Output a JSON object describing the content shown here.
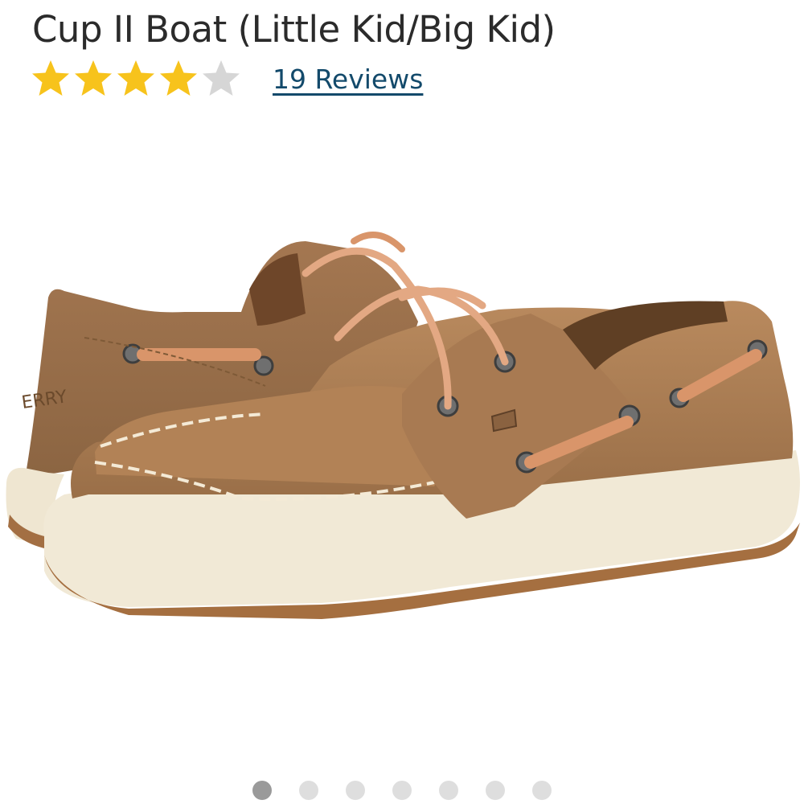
{
  "product": {
    "title": "Cup II Boat (Little Kid/Big Kid)",
    "rating": 4,
    "rating_max": 5,
    "reviews_label": "19 Reviews",
    "logo_text": "ERRY"
  },
  "colors": {
    "star_filled": "#f7c31c",
    "star_empty": "#d6d6d6",
    "link": "#134a6b"
  },
  "carousel": {
    "count": 7,
    "active_index": 0
  }
}
